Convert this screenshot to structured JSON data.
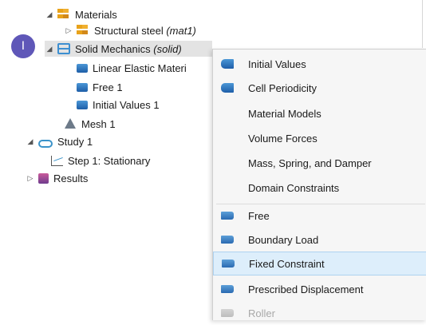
{
  "tree": {
    "materials": "Materials",
    "structural_steel": "Structural steel",
    "structural_steel_tag": "(mat1)",
    "solid_mechanics": "Solid Mechanics",
    "solid_mechanics_tag": "(solid)",
    "linear_elastic": "Linear Elastic Materi",
    "free": "Free 1",
    "initial_values": "Initial Values 1",
    "mesh": "Mesh 1",
    "study": "Study 1",
    "step": "Step 1: Stationary",
    "results": "Results"
  },
  "marker_label": "I",
  "context_menu": {
    "domain_items": [
      "Initial Values",
      "Cell Periodicity",
      "Material Models",
      "Volume Forces",
      "Mass, Spring, and Damper",
      "Domain Constraints"
    ],
    "boundary_items": [
      "Free",
      "Boundary Load",
      "Fixed Constraint",
      "Prescribed Displacement",
      "Roller"
    ],
    "highlighted": "Fixed Constraint",
    "disabled": "Roller"
  },
  "icons": {
    "materials": "materials-icon",
    "material": "material-icon",
    "physics": "solid-mechanics-icon",
    "feature": "physics-feature-icon",
    "mesh": "mesh-icon",
    "study": "study-icon",
    "step": "study-step-icon",
    "results": "results-icon"
  },
  "colors": {
    "marker": "#5f57b8",
    "selection": "#e3e3e3",
    "menu_highlight": "#ddeefb",
    "icon_blue": "#1e5ea8"
  }
}
